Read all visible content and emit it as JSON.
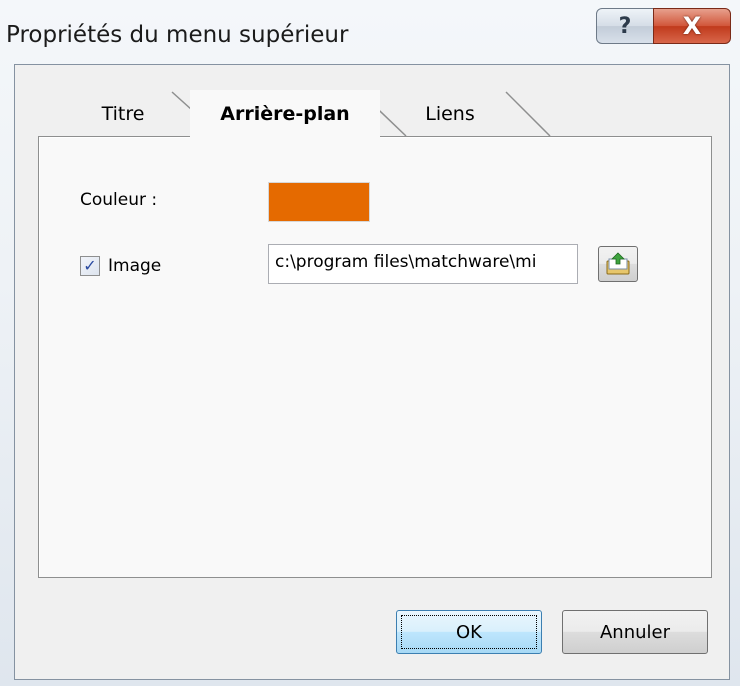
{
  "window": {
    "title": "Propriétés du menu supérieur",
    "help_label": "?",
    "close_label": "X"
  },
  "tabs": [
    {
      "label": "Titre",
      "active": false
    },
    {
      "label": "Arrière-plan",
      "active": true
    },
    {
      "label": "Liens",
      "active": false
    }
  ],
  "background_tab": {
    "color_label": "Couleur :",
    "color_value": "#e56a00",
    "image_label": "Image",
    "image_checked": true,
    "image_path": "c:\\program files\\matchware\\mi"
  },
  "buttons": {
    "ok_label": "OK",
    "cancel_label": "Annuler"
  },
  "icons": {
    "browse": "folder-upload-icon",
    "help": "help-icon",
    "close": "close-icon"
  }
}
